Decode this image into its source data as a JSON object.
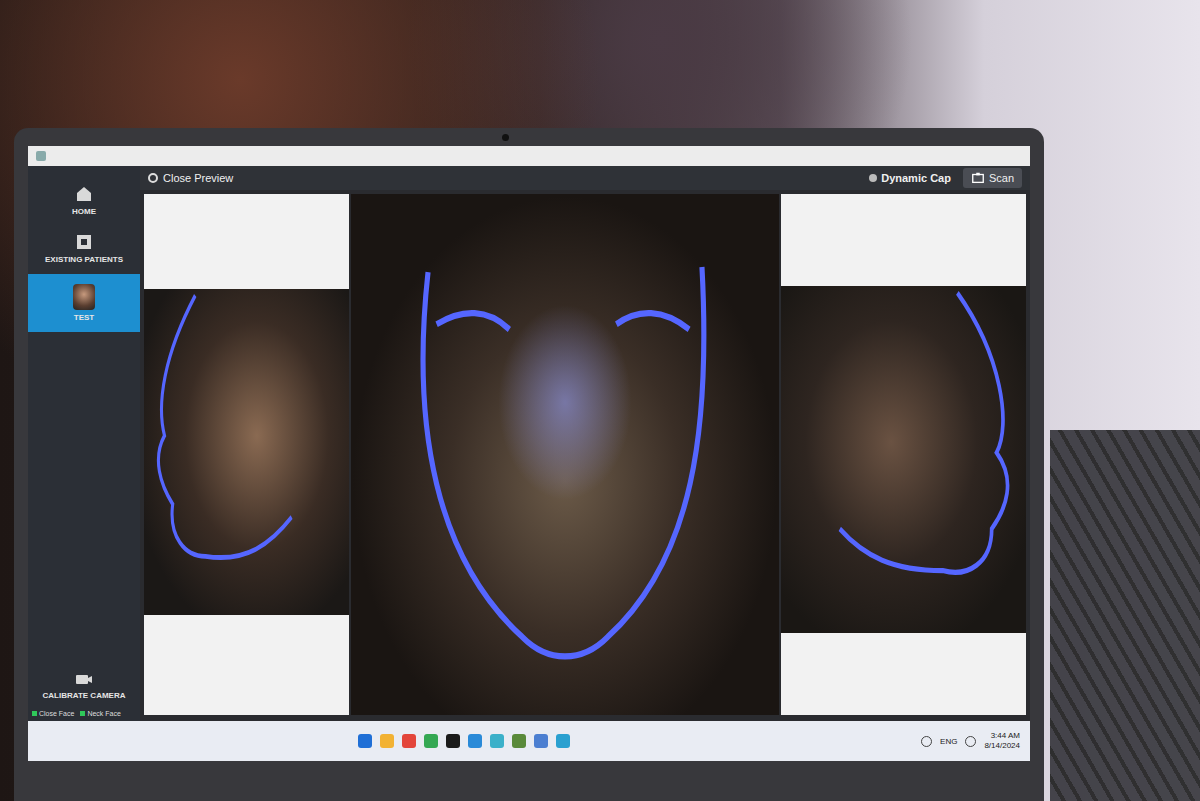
{
  "header": {
    "back": "Close Preview",
    "mode": "Dynamic Cap",
    "action": "Scan"
  },
  "sidebar": {
    "items": [
      {
        "label": "HOME",
        "kind": "home",
        "selected": false
      },
      {
        "label": "EXISTING PATIENTS",
        "kind": "patients",
        "selected": false
      },
      {
        "label": "TEST",
        "kind": "patient",
        "selected": true
      }
    ],
    "footer": "CALIBRATE CAMERA"
  },
  "status": [
    {
      "label": "Close Face",
      "on": true
    },
    {
      "label": "Neck Face",
      "on": true
    }
  ],
  "views": [
    {
      "kind": "profile-left"
    },
    {
      "kind": "front"
    },
    {
      "kind": "profile-right"
    }
  ],
  "taskbar": {
    "language": "ENG",
    "time": "3:44 AM",
    "date": "8/14/2024"
  }
}
